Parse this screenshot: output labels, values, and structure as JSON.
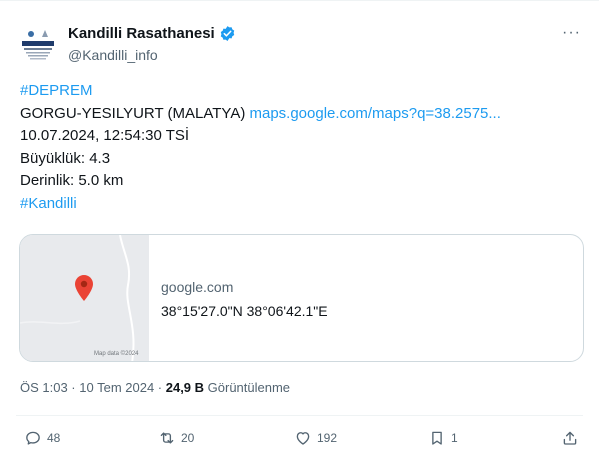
{
  "tweet": {
    "display_name": "Kandilli Rasathanesi",
    "handle": "@Kandilli_info",
    "more_icon": "more-dots-icon",
    "body": {
      "hashtag1": "#DEPREM",
      "location": "GORGU-YESILYURT (MALATYA) ",
      "map_link": "maps.google.com/maps?q=38.2575...",
      "datetime": "10.07.2024, 12:54:30 TSİ",
      "magnitude": "Büyüklük: 4.3",
      "depth": "Derinlik: 5.0 km",
      "hashtag2": "#Kandilli"
    },
    "card": {
      "domain": "google.com",
      "title": "38°15'27.0\"N 38°06'42.1\"E",
      "map_attribution": "Map data ©2024"
    },
    "meta": {
      "timestamp": "ÖS 1:03 · 10 Tem 2024 · ",
      "views_count": "24,9 B",
      "views_label": " Görüntülenme"
    },
    "actions": {
      "replies": "48",
      "reposts": "20",
      "likes": "192",
      "bookmarks": "1"
    },
    "colors": {
      "link": "#1d9bf0",
      "verified": "#1d9bf0",
      "map_pin": "#ea4335",
      "muted": "#536471"
    }
  }
}
